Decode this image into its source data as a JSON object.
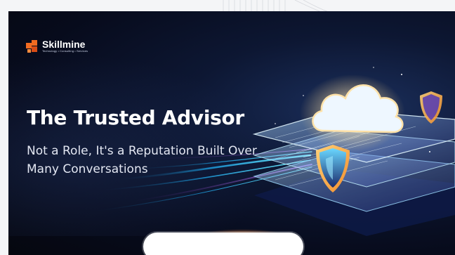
{
  "banner": {
    "brand": {
      "name": "Skillmine",
      "tagline": "Technology • Consulting • Services"
    },
    "headline": "The Trusted Advisor",
    "subtitle": "Not a Role, It's a Reputation Built Over Many Conversations"
  },
  "colors": {
    "background": "#05070f",
    "accent_orange": "#f26b21",
    "accent_cyan": "#36e0ff",
    "text": "#ffffff"
  },
  "icons": [
    "skillmine-logo-icon",
    "cloud-icon",
    "shield-icon",
    "small-shield-icon"
  ]
}
